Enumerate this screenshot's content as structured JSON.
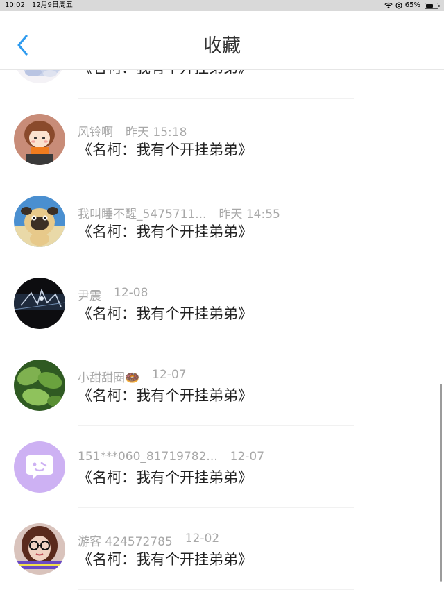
{
  "status_bar": {
    "time": "10:02",
    "date": "12月9日周五",
    "battery": "65%",
    "battery_level": 0.65,
    "icons": [
      "wifi-icon",
      "at-icon",
      "battery-icon"
    ]
  },
  "nav": {
    "back_icon": "chevron-left-icon",
    "title": "收藏",
    "accent": "#2e9bef"
  },
  "items": [
    {
      "username": "",
      "time": "",
      "title": "《名柯：我有个开挂弟弟》",
      "avatar": "flower-avatar"
    },
    {
      "username": "风铃啊",
      "time": "昨天 15:18",
      "title": "《名柯：我有个开挂弟弟》",
      "avatar": "cartoon-girl-avatar"
    },
    {
      "username": "我叫睡不醒_5475711...",
      "time": "昨天 14:55",
      "title": "《名柯：我有个开挂弟弟》",
      "avatar": "pug-avatar"
    },
    {
      "username": "尹震",
      "time": "12-08",
      "title": "《名柯：我有个开挂弟弟》",
      "avatar": "dark-scene-avatar"
    },
    {
      "username": "小甜甜圈🍩",
      "time": "12-07",
      "title": "《名柯：我有个开挂弟弟》",
      "avatar": "green-leaves-avatar"
    },
    {
      "username": "151***060_81719782...",
      "time": "12-07",
      "title": "《名柯：我有个开挂弟弟》",
      "avatar": "chat-bubble-avatar"
    },
    {
      "username": "游客 424572785",
      "time": "12-02",
      "title": "《名柯：我有个开挂弟弟》",
      "avatar": "glasses-person-avatar"
    }
  ]
}
